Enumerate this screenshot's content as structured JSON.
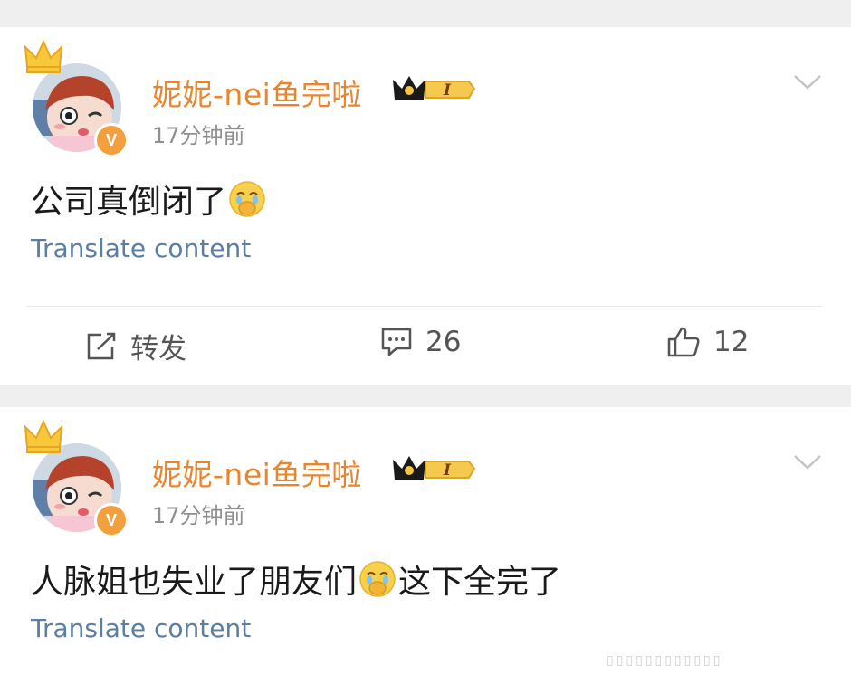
{
  "posts": [
    {
      "username": "妮妮-nei鱼完啦",
      "level_badge": "I",
      "timestamp": "17分钟前",
      "verified_mark": "V",
      "content_text": "公司真倒闭了",
      "translate_label": "Translate content",
      "actions": {
        "repost_label": "转发",
        "comment_count": "26",
        "like_count": "12"
      }
    },
    {
      "username": "妮妮-nei鱼完啦",
      "level_badge": "I",
      "timestamp": "17分钟前",
      "verified_mark": "V",
      "content_text_before": "人脉姐也失业了朋友们",
      "content_text_after": "这下全完了",
      "translate_label": "Translate content"
    }
  ],
  "icons": [
    "avatar",
    "crown-icon",
    "verified-badge",
    "level-crown-badge",
    "chevron-down-icon",
    "crying-emoji-icon",
    "repost-icon",
    "comment-icon",
    "like-icon"
  ],
  "colors": {
    "username": "#e8862f",
    "link": "#5b7fa3",
    "verified": "#f2a03d",
    "background": "#efefef"
  }
}
